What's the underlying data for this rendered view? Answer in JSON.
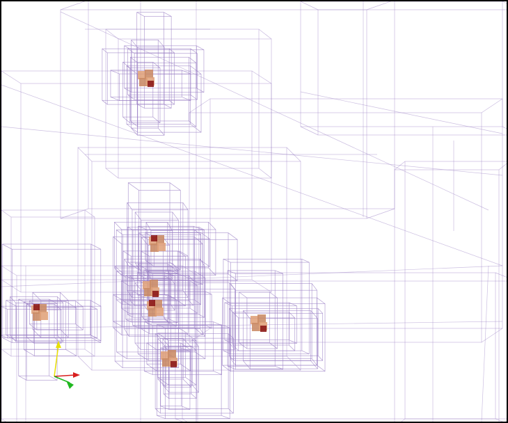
{
  "viewport": {
    "background": "#ffffff",
    "wire_color": "#9a7fc4",
    "cube_light": "#e0a27a",
    "cube_mid": "#c98a64",
    "cube_dark": "#8a1616"
  },
  "axes_gizmo": {
    "x_color": "#d81e1e",
    "y_color": "#e8e000",
    "z_color": "#1fb81f"
  },
  "icons": [
    "axes-gizmo-icon"
  ]
}
